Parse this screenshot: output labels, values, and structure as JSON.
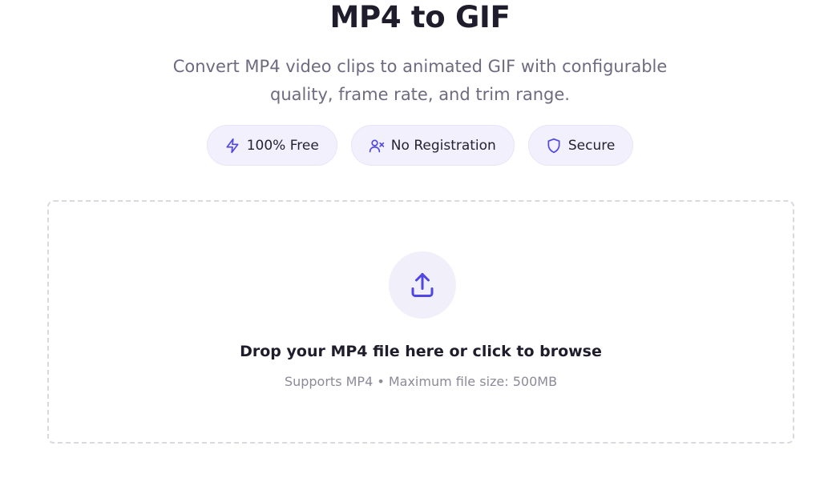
{
  "header": {
    "title": "MP4 to GIF",
    "subtitle": "Convert MP4 video clips to animated GIF with configurable quality, frame rate, and trim range."
  },
  "badges": [
    {
      "icon": "lightning-icon",
      "label": "100% Free"
    },
    {
      "icon": "user-x-icon",
      "label": "No Registration"
    },
    {
      "icon": "shield-icon",
      "label": "Secure"
    }
  ],
  "dropzone": {
    "icon": "upload-icon",
    "title": "Drop your MP4 file here or click to browse",
    "hint": "Supports MP4 • Maximum file size: 500MB"
  },
  "colors": {
    "accent": "#4f46e5",
    "badge_bg": "#f1f0fc",
    "text_dark": "#1f1c2c",
    "text_muted": "#6e6a80"
  }
}
